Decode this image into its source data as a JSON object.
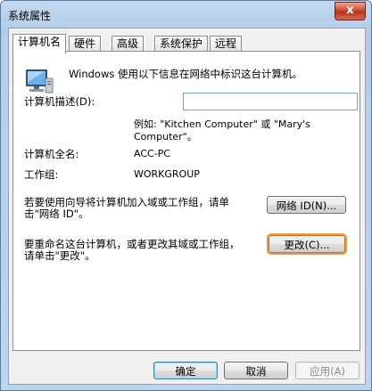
{
  "window": {
    "title": "系统属性",
    "close_label": "x"
  },
  "tabs": [
    {
      "label": "计算机名",
      "active": true
    },
    {
      "label": "硬件",
      "active": false
    },
    {
      "label": "高级",
      "active": false
    },
    {
      "label": "系统保护",
      "active": false
    },
    {
      "label": "远程",
      "active": false
    }
  ],
  "panel": {
    "intro": "Windows 使用以下信息在网络中标识这台计算机。",
    "description_label": "计算机描述(D):",
    "description_value": "",
    "example_line1": "例如: \"Kitchen Computer\" 或 \"Mary's",
    "example_line2": "Computer\"。",
    "fullname_label": "计算机全名:",
    "fullname_value": "ACC-PC",
    "workgroup_label": "工作组:",
    "workgroup_value": "WORKGROUP",
    "network_text_line1": "若要使用向导将计算机加入域或工作组，请单",
    "network_text_line2": "击\"网络 ID\"。",
    "network_id_button": "网络 ID(N)...",
    "change_text_line1": "要重命名这台计算机，或者更改其域或工作组，",
    "change_text_line2": "请单击\"更改\"。",
    "change_button": "更改(C)..."
  },
  "footer": {
    "ok": "确定",
    "cancel": "取消",
    "apply": "应用(A)"
  }
}
